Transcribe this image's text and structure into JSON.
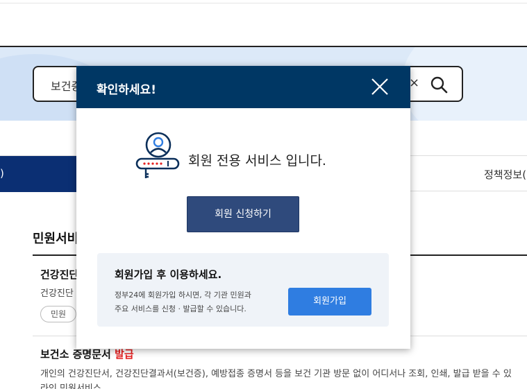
{
  "search": {
    "value": "보건증",
    "clear_icon": "close-icon",
    "submit_icon": "search-icon"
  },
  "nav": {
    "active_label": ")",
    "right_label": "정책정보("
  },
  "content": {
    "section_title": "민원서비",
    "item1": {
      "title": "건강진단",
      "desc": "건강진단",
      "tag": "민원"
    },
    "item2": {
      "title": "보건소 증명문서",
      "title_badge": "발급",
      "desc": "개인의 건강진단서, 건강진단결과서(보건증), 예방접종 증명서 등을 보건 기관 방문 없이 어디서나 조회, 인쇄, 발급 받을 수 있",
      "desc2": "라인 민원서비스"
    }
  },
  "modal": {
    "title": "확인하세요!",
    "message": "회원 전용 서비스 입니다.",
    "apply_button": "회원 신청하기",
    "info": {
      "title": "회원가입 후 이용하세요.",
      "desc_line1": "정부24에 회원가입 하시면, 각 기관 민원과",
      "desc_line2": "주요 서비스를 신청 · 발급할 수 있습니다.",
      "join_button": "회원가입"
    },
    "colors": {
      "header": "#003764",
      "apply_button": "#2f4a7c",
      "join_button": "#2f7de1"
    }
  }
}
